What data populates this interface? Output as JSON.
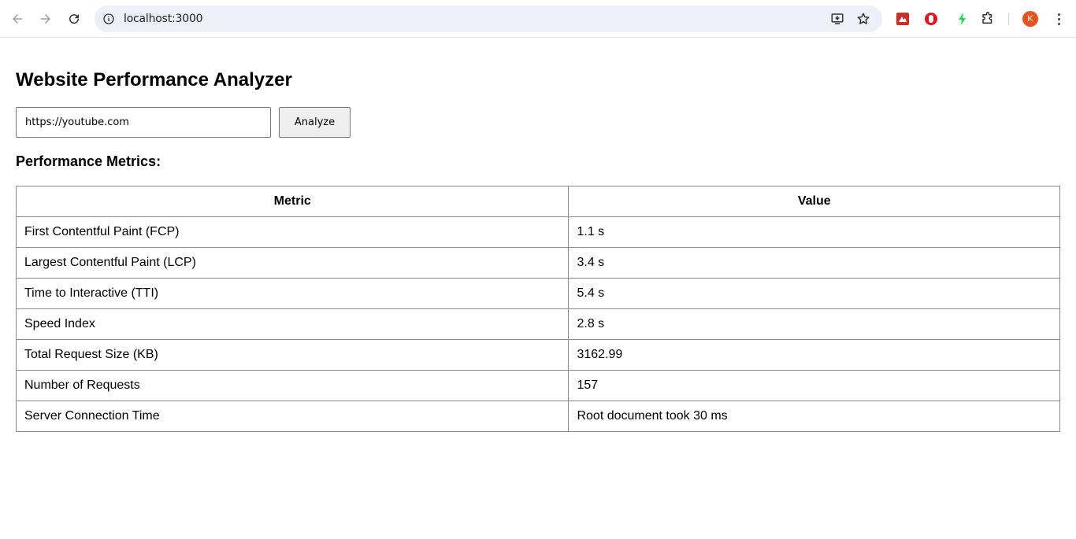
{
  "browser": {
    "url": "localhost:3000",
    "profile_initial": "K"
  },
  "page": {
    "title": "Website Performance Analyzer",
    "url_input_value": "https://youtube.com",
    "analyze_label": "Analyze",
    "section_title": "Performance Metrics:"
  },
  "table": {
    "headers": [
      "Metric",
      "Value"
    ],
    "rows": [
      [
        "First Contentful Paint (FCP)",
        "1.1 s"
      ],
      [
        "Largest Contentful Paint (LCP)",
        "3.4 s"
      ],
      [
        "Time to Interactive (TTI)",
        "5.4 s"
      ],
      [
        "Speed Index",
        "2.8 s"
      ],
      [
        "Total Request Size (KB)",
        "3162.99"
      ],
      [
        "Number of Requests",
        "157"
      ],
      [
        "Server Connection Time",
        "Root document took 30 ms"
      ]
    ]
  },
  "colors": {
    "omnibox_bg": "#edf0f8",
    "avatar_bg": "#e8541e",
    "button_bg": "#efefef",
    "table_border": "#8a8a8a"
  }
}
